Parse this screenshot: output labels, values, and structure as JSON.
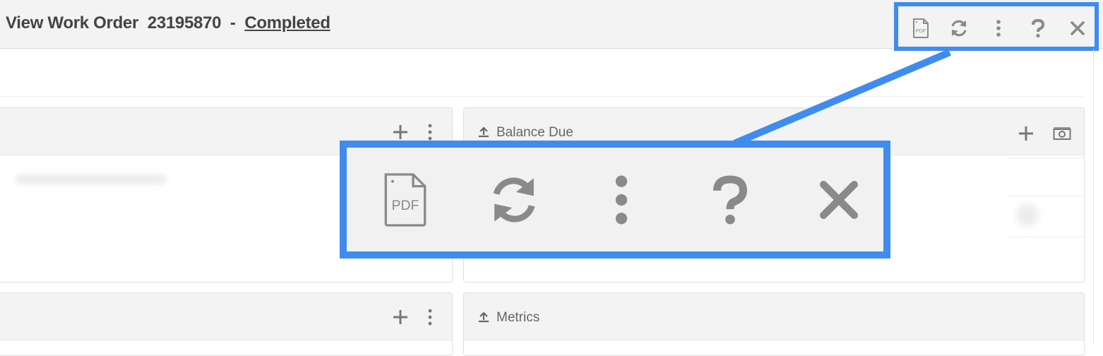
{
  "header": {
    "title_prefix": "View Work Order",
    "order_number": "23195870",
    "separator": "-",
    "status": "Completed"
  },
  "toolbar": {
    "icons": [
      "pdf-icon",
      "refresh-icon",
      "more-vertical-icon",
      "help-icon",
      "close-icon"
    ],
    "pdf_label": "PDF"
  },
  "panels": {
    "balance_due": {
      "title": "Balance Due",
      "icon": "upload-icon",
      "actions": [
        "plus-icon",
        "money-icon"
      ]
    },
    "metrics": {
      "title": "Metrics",
      "icon": "upload-icon"
    },
    "left_top": {
      "actions": [
        "plus-icon",
        "more-vertical-icon"
      ]
    },
    "left_bottom": {
      "actions": [
        "plus-icon",
        "more-vertical-icon"
      ]
    }
  },
  "colors": {
    "highlight": "#3f8cf0",
    "header_bg": "#f3f3f3",
    "icon_gray": "#8a8a8a",
    "title_text": "#444444"
  }
}
